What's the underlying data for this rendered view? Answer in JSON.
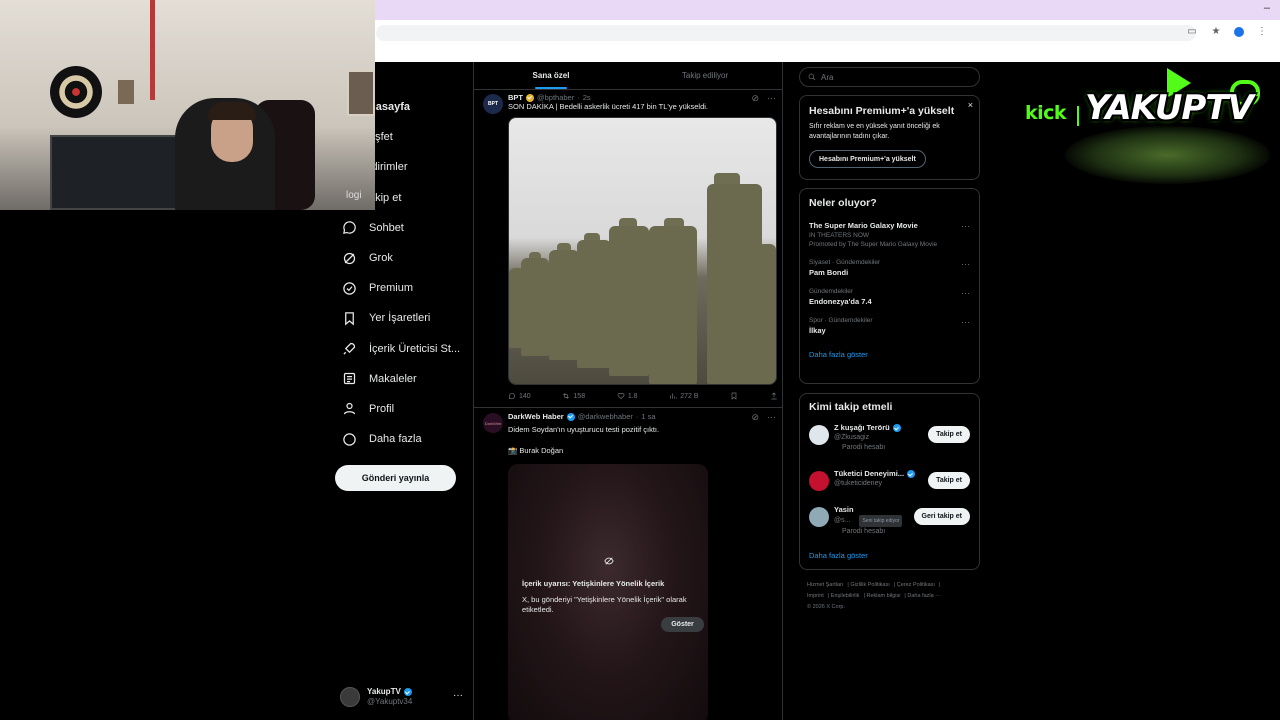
{
  "main": {
    "tabs": [
      "Sana özel",
      "Takip ediliyor"
    ],
    "tweets": [
      {
        "name": "BPT",
        "handle": "@bpthaber",
        "time": "2s",
        "text": "SON DAKİKA | Bedelli askerlik ücreti 417 bin TL'ye yükseldi.",
        "avatar_text": "BPT",
        "stats": {
          "replies": "140",
          "retweets": "158",
          "likes": "1.8",
          "views": "272 B"
        }
      },
      {
        "name": "DarkWeb Haber",
        "handle": "@darkwebhaber",
        "time": "1 sa",
        "text": "Didem Soydan'ın uyuşturucu testi pozitif çıktı.",
        "text2": "📸 Burak Doğan",
        "avatar_text": "DarkWeb",
        "nsfw": {
          "title": "İçerik uyarısı: Yetişkinlere Yönelik İçerik",
          "desc": "X, bu gönderiyi \"Yetişkinlere Yönelik İçerik\" olarak etiketledi.",
          "button": "Göster"
        }
      }
    ]
  },
  "sidebar": {
    "items": [
      {
        "label": "Anasayfa",
        "icon": "home-icon"
      },
      {
        "label": "Keşfet",
        "icon": "search-icon"
      },
      {
        "label": "Bildirimler",
        "icon": "bell-icon"
      },
      {
        "label": "Takip et",
        "icon": "follow-icon"
      },
      {
        "label": "Sohbet",
        "icon": "chat-icon"
      },
      {
        "label": "Grok",
        "icon": "grok-icon"
      },
      {
        "label": "Premium",
        "icon": "premium-icon"
      },
      {
        "label": "Yer İşaretleri",
        "icon": "bookmark-icon"
      },
      {
        "label": "İçerik Üreticisi St...",
        "icon": "rocket-icon"
      },
      {
        "label": "Makaleler",
        "icon": "article-icon"
      },
      {
        "label": "Profil",
        "icon": "profile-icon"
      },
      {
        "label": "Daha fazla",
        "icon": "more-icon"
      }
    ],
    "visible_labels": [
      "nasayfa",
      "eşfet",
      "ldirimler",
      "akip et",
      "Sohbet",
      "Grok",
      "Premium",
      "Yer İşaretleri",
      "İçerik Üreticisi St...",
      "Makaleler",
      "Profil",
      "Daha fazla"
    ],
    "post_button": "Gönderi yayınla",
    "me": {
      "name": "YakupTV",
      "handle": "@Yakuptv34"
    }
  },
  "right": {
    "search_placeholder": "Ara",
    "premium": {
      "title": "Hesabını Premium+'a yükselt",
      "desc": "Sıfır reklam ve en yüksek yanıt önceliği ek avantajlarının tadını çıkar.",
      "button": "Hesabını Premium+'a yükselt",
      "close": "×"
    },
    "trends": {
      "title": "Neler oluyor?",
      "items": [
        {
          "context": "",
          "name": "The Super Mario Galaxy Movie",
          "sub": "IN THEATERS NOW",
          "sub2": "Promoted by The Super Mario Galaxy Movie"
        },
        {
          "context": "Siyaset · Gündemdekiler",
          "name": "Pam Bondi"
        },
        {
          "context": "Gündemdekiler",
          "name": "Endonezya'da 7.4"
        },
        {
          "context": "Spor · Gündemdekiler",
          "name": "İlkay"
        }
      ],
      "show_more": "Daha fazla göster"
    },
    "who_to_follow": {
      "title": "Kimi takip etmeli",
      "items": [
        {
          "name": "Z kuşağı Terörü",
          "handle": "@Zkusagiz",
          "parody": "Parodi hesabı",
          "button": "Takip et"
        },
        {
          "name": "Tüketici Deneyimi...",
          "handle": "@tuketicideney",
          "parody": "",
          "button": "Takip et"
        },
        {
          "name": "Yasin",
          "handle": "@s...",
          "follows_you": "Seni takip ediyor",
          "parody": "Parodi hesabı",
          "button": "Geri takip et"
        }
      ],
      "show_more": "Daha fazla göster"
    },
    "footer": {
      "line1": [
        "Hizmet Şartları",
        "Gizlilik Politikası",
        "Çerez Politikası"
      ],
      "line2": [
        "Imprint",
        "Erişilebilirlik",
        "Reklam bilgisi",
        "Daha fazla ···"
      ],
      "line3": "© 2026 X Corp."
    }
  },
  "overlay": {
    "kick_word": "kick",
    "brand": "YAKUPTV",
    "webcam_label": "logi"
  },
  "colors": {
    "accent": "#1d9bf0",
    "kick_green": "#53fc18",
    "bg": "#000000",
    "border": "#2f3336"
  }
}
